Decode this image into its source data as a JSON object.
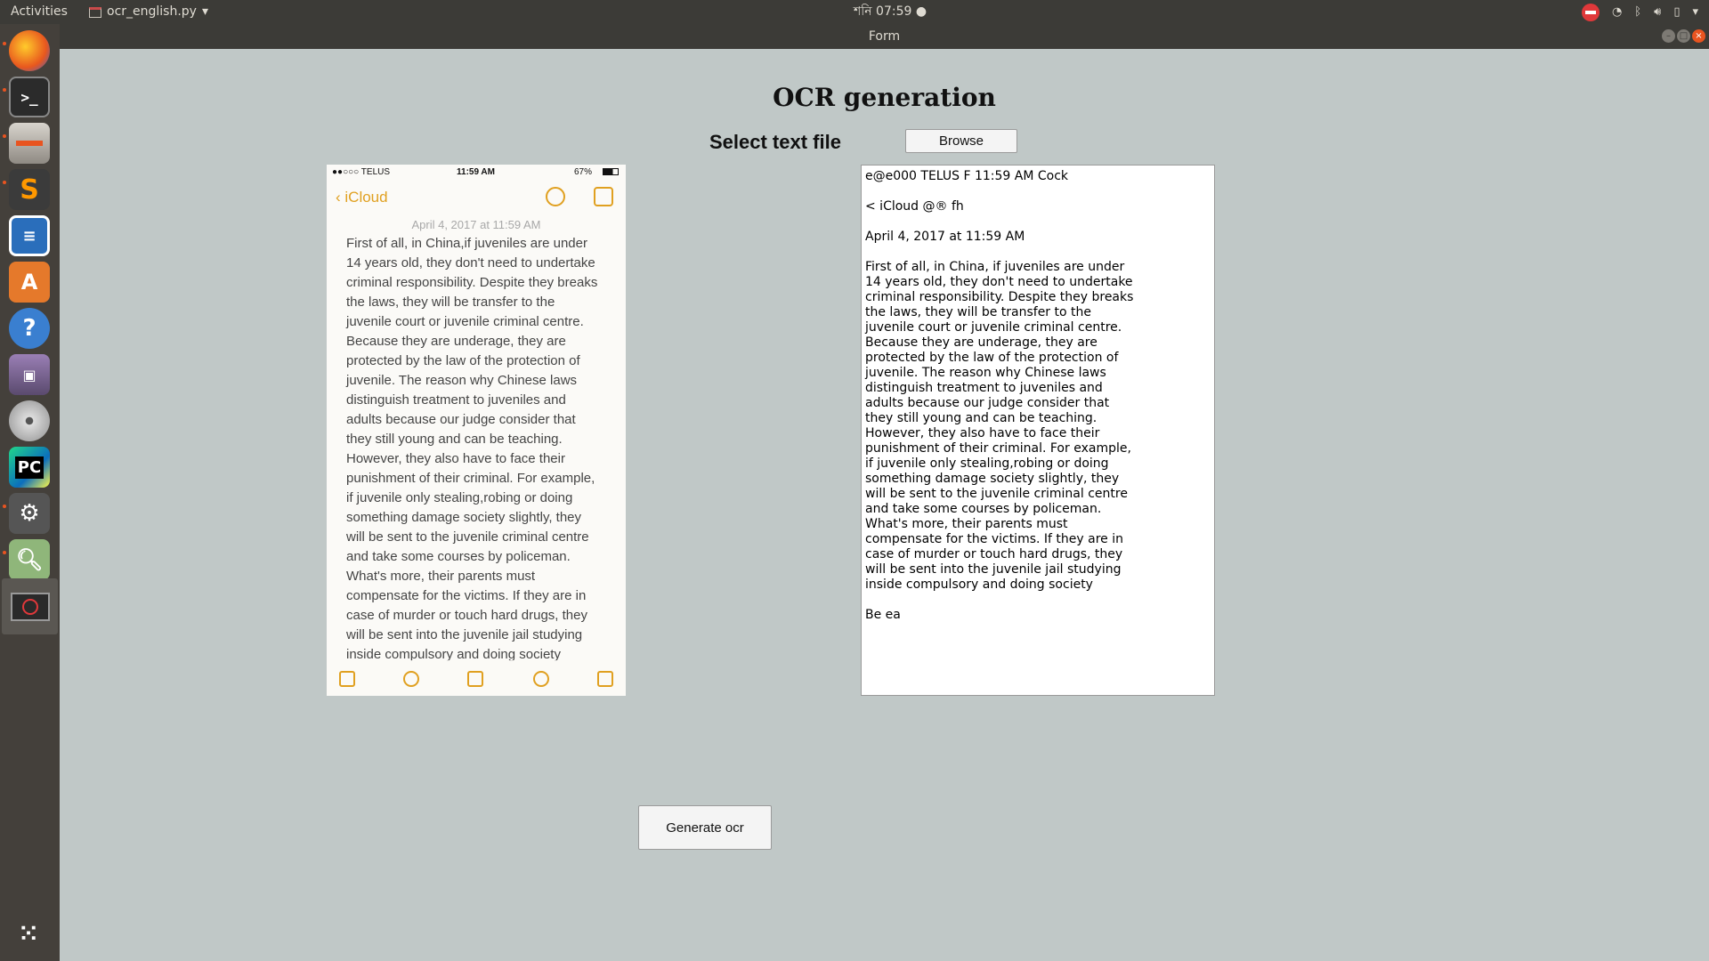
{
  "topbar": {
    "activities": "Activities",
    "app_name": "ocr_english.py",
    "clock": "শনি 07:59"
  },
  "window": {
    "title": "Form"
  },
  "form": {
    "heading": "OCR generation",
    "select_label": "Select text file",
    "browse_label": "Browse",
    "generate_label": "Generate ocr"
  },
  "preview": {
    "carrier": "●●○○○ TELUS",
    "time": "11:59 AM",
    "battery": "67%",
    "back_label": "iCloud",
    "date": "April 4, 2017 at 11:59 AM",
    "note_text": "First of all, in China,if juveniles are under\n14 years old, they don't need to undertake\ncriminal responsibility. Despite they breaks\nthe laws, they will be transfer to the\njuvenile court or juvenile criminal centre.\nBecause they are underage, they are\nprotected by the law of the protection of\njuvenile. The reason why Chinese laws\ndistinguish treatment to juveniles and\nadults because our judge consider that\nthey still young and can be teaching.\nHowever, they also have to face their\npunishment of their criminal. For example,\nif juvenile only stealing,robing or doing\nsomething damage society slightly, they\nwill be sent to the juvenile criminal centre\nand take some courses by policeman.\nWhat's more, their parents must\ncompensate for the victims. If they are in\ncase of murder or touch hard drugs, they\nwill be sent into the juvenile jail studying\ninside compulsory and doing society"
  },
  "ocr_output": {
    "text": "e@e000 TELUS F 11:59 AM Cock\n\n< iCloud @® fh\n\nApril 4, 2017 at 11:59 AM\n\nFirst of all, in China, if juveniles are under\n14 years old, they don't need to undertake\ncriminal responsibility. Despite they breaks\nthe laws, they will be transfer to the\njuvenile court or juvenile criminal centre.\nBecause they are underage, they are\nprotected by the law of the protection of\njuvenile. The reason why Chinese laws\ndistinguish treatment to juveniles and\nadults because our judge consider that\nthey still young and can be teaching.\nHowever, they also have to face their\npunishment of their criminal. For example,\nif juvenile only stealing,robing or doing\nsomething damage society slightly, they\nwill be sent to the juvenile criminal centre\nand take some courses by policeman.\nWhat's more, their parents must\ncompensate for the victims. If they are in\ncase of murder or touch hard drugs, they\nwill be sent into the juvenile jail studying\ninside compulsory and doing society\n\nBe ea"
  },
  "dock": {
    "items": [
      "firefox-icon",
      "terminal-icon",
      "files-icon",
      "sublime-text-icon",
      "writer-icon",
      "software-center-icon",
      "help-icon",
      "video-editor-icon",
      "disc-icon",
      "pycharm-icon",
      "settings-tool-icon",
      "image-viewer-icon",
      "no-entry-app-icon",
      "app-grid-icon"
    ]
  },
  "colors": {
    "background": "#c0c8c7",
    "topbar": "#3c3b37",
    "dock": "#44403b",
    "accent": "#e95420"
  }
}
